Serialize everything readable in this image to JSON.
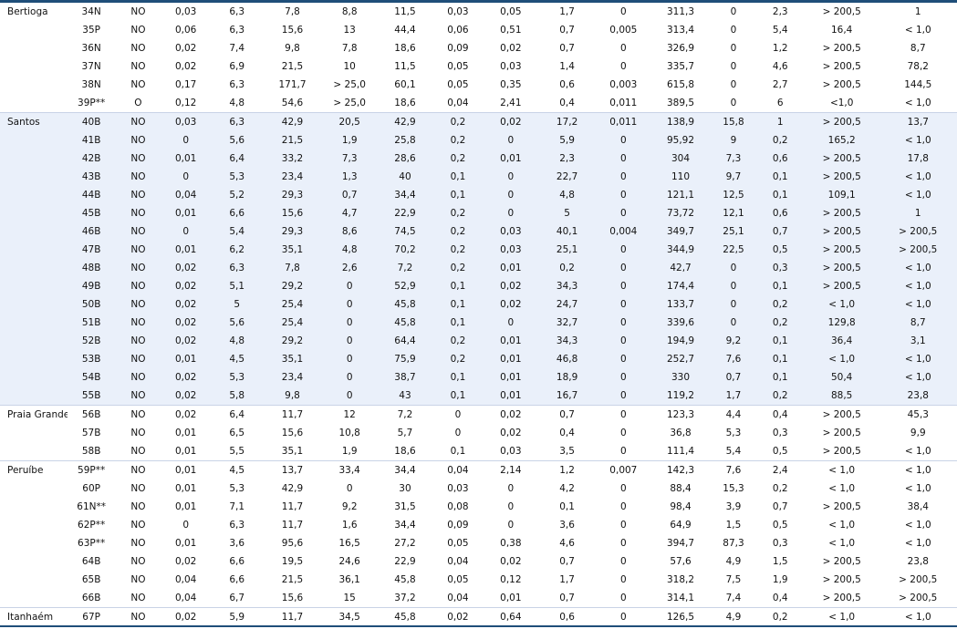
{
  "groups": [
    {
      "municipality": "Bertioga",
      "shaded": false,
      "rows": [
        [
          "34N",
          "NO",
          "0,03",
          "6,3",
          "7,8",
          "8,8",
          "11,5",
          "0,03",
          "0,05",
          "1,7",
          "0",
          "311,3",
          "0",
          "2,3",
          "> 200,5",
          "1"
        ],
        [
          "35P",
          "NO",
          "0,06",
          "6,3",
          "15,6",
          "13",
          "44,4",
          "0,06",
          "0,51",
          "0,7",
          "0,005",
          "313,4",
          "0",
          "5,4",
          "16,4",
          "< 1,0"
        ],
        [
          "36N",
          "NO",
          "0,02",
          "7,4",
          "9,8",
          "7,8",
          "18,6",
          "0,09",
          "0,02",
          "0,7",
          "0",
          "326,9",
          "0",
          "1,2",
          "> 200,5",
          "8,7"
        ],
        [
          "37N",
          "NO",
          "0,02",
          "6,9",
          "21,5",
          "10",
          "11,5",
          "0,05",
          "0,03",
          "1,4",
          "0",
          "335,7",
          "0",
          "4,6",
          "> 200,5",
          "78,2"
        ],
        [
          "38N",
          "NO",
          "0,17",
          "6,3",
          "171,7",
          "> 25,0",
          "60,1",
          "0,05",
          "0,35",
          "0,6",
          "0,003",
          "615,8",
          "0",
          "2,7",
          "> 200,5",
          "144,5"
        ],
        [
          "39P**",
          "O",
          "0,12",
          "4,8",
          "54,6",
          "> 25,0",
          "18,6",
          "0,04",
          "2,41",
          "0,4",
          "0,011",
          "389,5",
          "0",
          "6",
          "<1,0",
          "< 1,0"
        ]
      ]
    },
    {
      "municipality": "Santos",
      "shaded": true,
      "rows": [
        [
          "40B",
          "NO",
          "0,03",
          "6,3",
          "42,9",
          "20,5",
          "42,9",
          "0,2",
          "0,02",
          "17,2",
          "0,011",
          "138,9",
          "15,8",
          "1",
          "> 200,5",
          "13,7"
        ],
        [
          "41B",
          "NO",
          "0",
          "5,6",
          "21,5",
          "1,9",
          "25,8",
          "0,2",
          "0",
          "5,9",
          "0",
          "95,92",
          "9",
          "0,2",
          "165,2",
          "< 1,0"
        ],
        [
          "42B",
          "NO",
          "0,01",
          "6,4",
          "33,2",
          "7,3",
          "28,6",
          "0,2",
          "0,01",
          "2,3",
          "0",
          "304",
          "7,3",
          "0,6",
          "> 200,5",
          "17,8"
        ],
        [
          "43B",
          "NO",
          "0",
          "5,3",
          "23,4",
          "1,3",
          "40",
          "0,1",
          "0",
          "22,7",
          "0",
          "110",
          "9,7",
          "0,1",
          "> 200,5",
          "< 1,0"
        ],
        [
          "44B",
          "NO",
          "0,04",
          "5,2",
          "29,3",
          "0,7",
          "34,4",
          "0,1",
          "0",
          "4,8",
          "0",
          "121,1",
          "12,5",
          "0,1",
          "109,1",
          "< 1,0"
        ],
        [
          "45B",
          "NO",
          "0,01",
          "6,6",
          "15,6",
          "4,7",
          "22,9",
          "0,2",
          "0",
          "5",
          "0",
          "73,72",
          "12,1",
          "0,6",
          "> 200,5",
          "1"
        ],
        [
          "46B",
          "NO",
          "0",
          "5,4",
          "29,3",
          "8,6",
          "74,5",
          "0,2",
          "0,03",
          "40,1",
          "0,004",
          "349,7",
          "25,1",
          "0,7",
          "> 200,5",
          "> 200,5"
        ],
        [
          "47B",
          "NO",
          "0,01",
          "6,2",
          "35,1",
          "4,8",
          "70,2",
          "0,2",
          "0,03",
          "25,1",
          "0",
          "344,9",
          "22,5",
          "0,5",
          "> 200,5",
          "> 200,5"
        ],
        [
          "48B",
          "NO",
          "0,02",
          "6,3",
          "7,8",
          "2,6",
          "7,2",
          "0,2",
          "0,01",
          "0,2",
          "0",
          "42,7",
          "0",
          "0,3",
          "> 200,5",
          "< 1,0"
        ],
        [
          "49B",
          "NO",
          "0,02",
          "5,1",
          "29,2",
          "0",
          "52,9",
          "0,1",
          "0,02",
          "34,3",
          "0",
          "174,4",
          "0",
          "0,1",
          "> 200,5",
          "< 1,0"
        ],
        [
          "50B",
          "NO",
          "0,02",
          "5",
          "25,4",
          "0",
          "45,8",
          "0,1",
          "0,02",
          "24,7",
          "0",
          "133,7",
          "0",
          "0,2",
          "< 1,0",
          "< 1,0"
        ],
        [
          "51B",
          "NO",
          "0,02",
          "5,6",
          "25,4",
          "0",
          "45,8",
          "0,1",
          "0",
          "32,7",
          "0",
          "339,6",
          "0",
          "0,2",
          "129,8",
          "8,7"
        ],
        [
          "52B",
          "NO",
          "0,02",
          "4,8",
          "29,2",
          "0",
          "64,4",
          "0,2",
          "0,01",
          "34,3",
          "0",
          "194,9",
          "9,2",
          "0,1",
          "36,4",
          "3,1"
        ],
        [
          "53B",
          "NO",
          "0,01",
          "4,5",
          "35,1",
          "0",
          "75,9",
          "0,2",
          "0,01",
          "46,8",
          "0",
          "252,7",
          "7,6",
          "0,1",
          "< 1,0",
          "< 1,0"
        ],
        [
          "54B",
          "NO",
          "0,02",
          "5,3",
          "23,4",
          "0",
          "38,7",
          "0,1",
          "0,01",
          "18,9",
          "0",
          "330",
          "0,7",
          "0,1",
          "50,4",
          "< 1,0"
        ],
        [
          "55B",
          "NO",
          "0,02",
          "5,8",
          "9,8",
          "0",
          "43",
          "0,1",
          "0,01",
          "16,7",
          "0",
          "119,2",
          "1,7",
          "0,2",
          "88,5",
          "23,8"
        ]
      ]
    },
    {
      "municipality": "Praia Grande",
      "shaded": false,
      "rows": [
        [
          "56B",
          "NO",
          "0,02",
          "6,4",
          "11,7",
          "12",
          "7,2",
          "0",
          "0,02",
          "0,7",
          "0",
          "123,3",
          "4,4",
          "0,4",
          "> 200,5",
          "45,3"
        ],
        [
          "57B",
          "NO",
          "0,01",
          "6,5",
          "15,6",
          "10,8",
          "5,7",
          "0",
          "0,02",
          "0,4",
          "0",
          "36,8",
          "5,3",
          "0,3",
          "> 200,5",
          "9,9"
        ],
        [
          "58B",
          "NO",
          "0,01",
          "5,5",
          "35,1",
          "1,9",
          "18,6",
          "0,1",
          "0,03",
          "3,5",
          "0",
          "111,4",
          "5,4",
          "0,5",
          "> 200,5",
          "< 1,0"
        ]
      ]
    },
    {
      "municipality": "Peruíbe",
      "shaded": false,
      "rows": [
        [
          "59P**",
          "NO",
          "0,01",
          "4,5",
          "13,7",
          "33,4",
          "34,4",
          "0,04",
          "2,14",
          "1,2",
          "0,007",
          "142,3",
          "7,6",
          "2,4",
          "< 1,0",
          "< 1,0"
        ],
        [
          "60P",
          "NO",
          "0,01",
          "5,3",
          "42,9",
          "0",
          "30",
          "0,03",
          "0",
          "4,2",
          "0",
          "88,4",
          "15,3",
          "0,2",
          "< 1,0",
          "< 1,0"
        ],
        [
          "61N**",
          "NO",
          "0,01",
          "7,1",
          "11,7",
          "9,2",
          "31,5",
          "0,08",
          "0",
          "0,1",
          "0",
          "98,4",
          "3,9",
          "0,7",
          "> 200,5",
          "38,4"
        ],
        [
          "62P**",
          "NO",
          "0",
          "6,3",
          "11,7",
          "1,6",
          "34,4",
          "0,09",
          "0",
          "3,6",
          "0",
          "64,9",
          "1,5",
          "0,5",
          "< 1,0",
          "< 1,0"
        ],
        [
          "63P**",
          "NO",
          "0,01",
          "3,6",
          "95,6",
          "16,5",
          "27,2",
          "0,05",
          "0,38",
          "4,6",
          "0",
          "394,7",
          "87,3",
          "0,3",
          "< 1,0",
          "< 1,0"
        ],
        [
          "64B",
          "NO",
          "0,02",
          "6,6",
          "19,5",
          "24,6",
          "22,9",
          "0,04",
          "0,02",
          "0,7",
          "0",
          "57,6",
          "4,9",
          "1,5",
          "> 200,5",
          "23,8"
        ],
        [
          "65B",
          "NO",
          "0,04",
          "6,6",
          "21,5",
          "36,1",
          "45,8",
          "0,05",
          "0,12",
          "1,7",
          "0",
          "318,2",
          "7,5",
          "1,9",
          "> 200,5",
          "> 200,5"
        ],
        [
          "66B",
          "NO",
          "0,04",
          "6,7",
          "15,6",
          "15",
          "37,2",
          "0,04",
          "0,01",
          "0,7",
          "0",
          "314,1",
          "7,4",
          "0,4",
          "> 200,5",
          "> 200,5"
        ]
      ]
    },
    {
      "municipality": "Itanhaém",
      "shaded": false,
      "rows": [
        [
          "67P",
          "NO",
          "0,02",
          "5,9",
          "11,7",
          "34,5",
          "45,8",
          "0,02",
          "0,64",
          "0,6",
          "0",
          "126,5",
          "4,9",
          "0,2",
          "< 1,0",
          "< 1,0"
        ]
      ]
    }
  ]
}
